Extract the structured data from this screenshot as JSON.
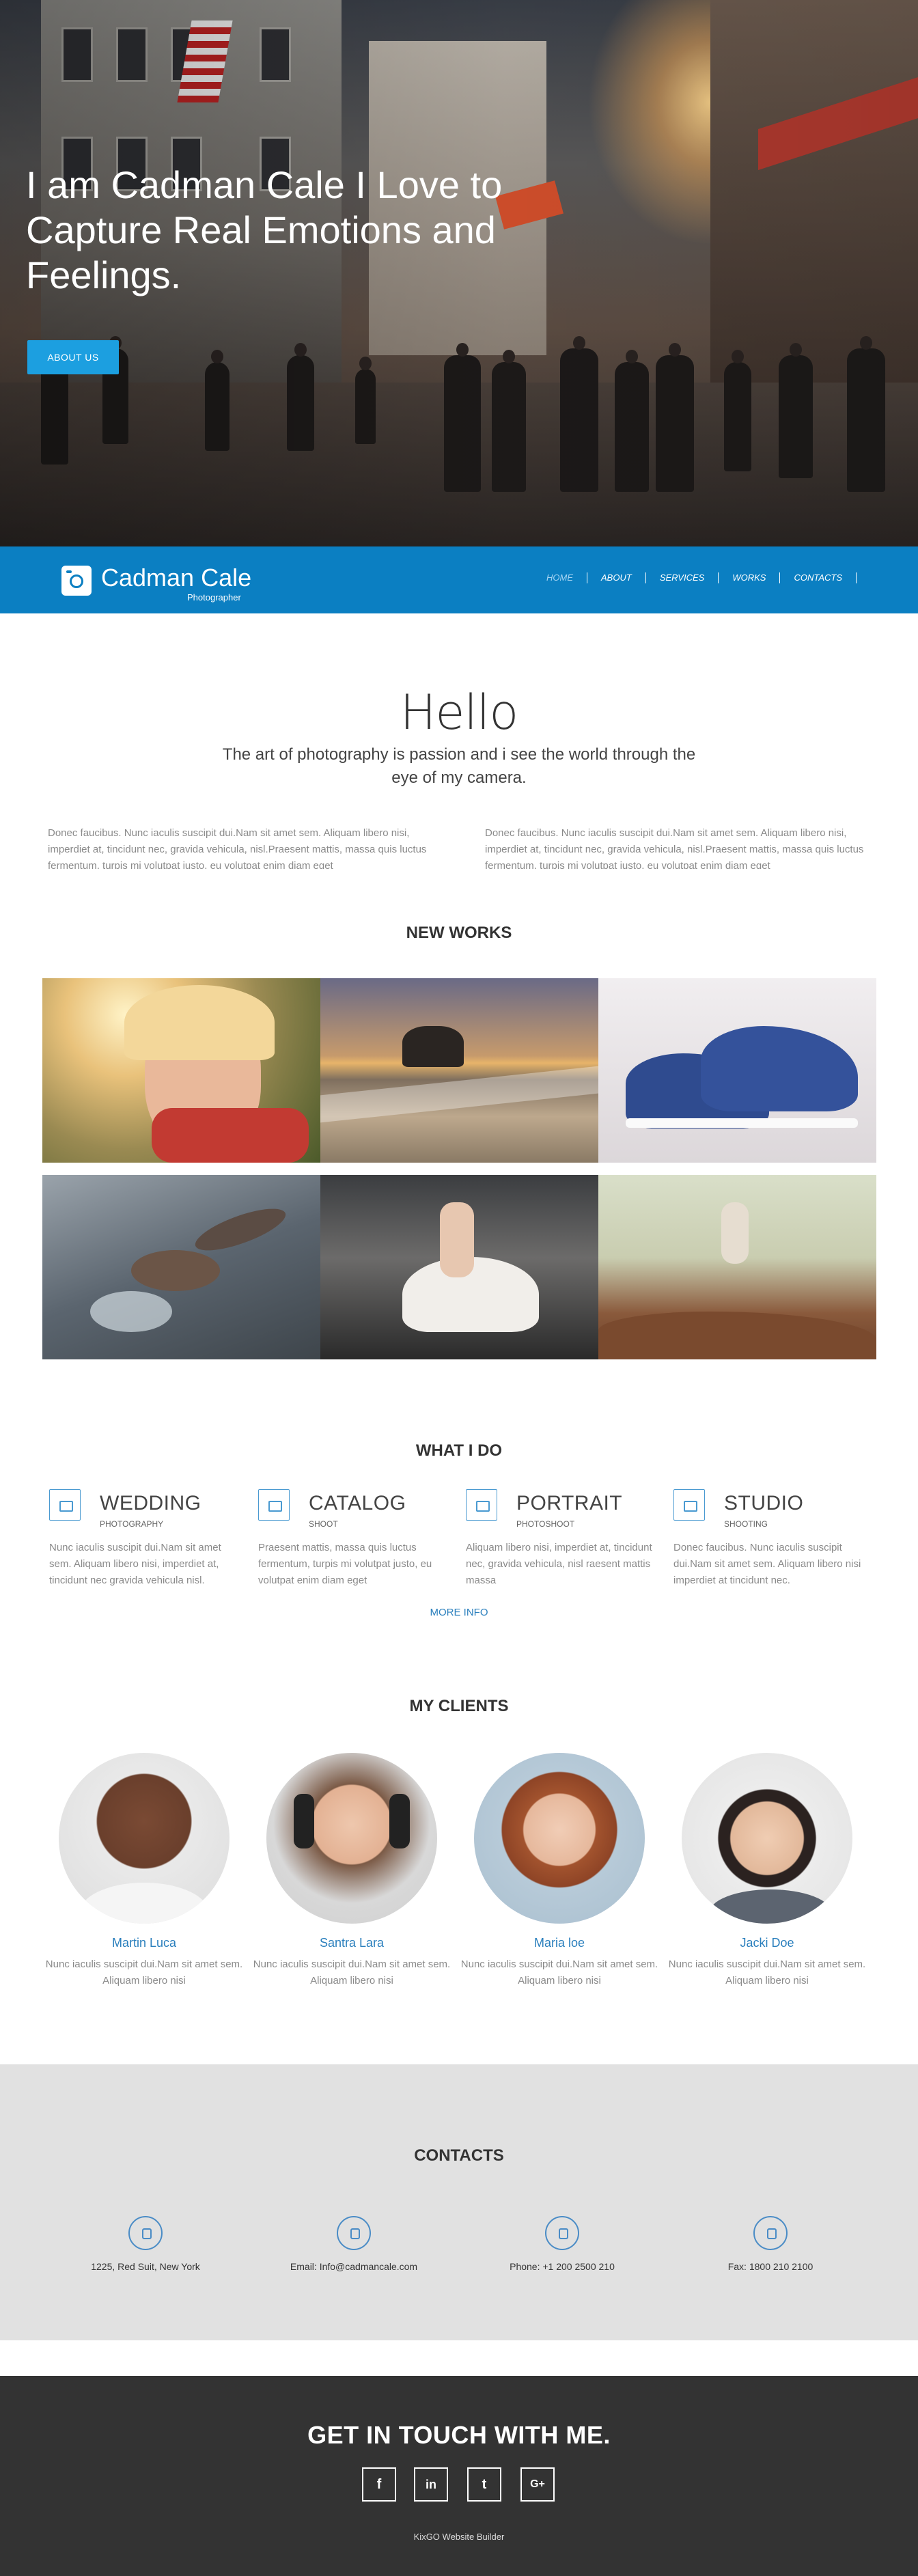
{
  "hero": {
    "title": "I am Cadman Cale I Love to Capture Real Emotions and Feelings.",
    "button_label": "ABOUT US"
  },
  "navbar": {
    "brand": "Cadman Cale",
    "tagline": "Photographer",
    "items": [
      {
        "label": "HOME",
        "active": true
      },
      {
        "label": "ABOUT",
        "active": false
      },
      {
        "label": "SERVICES",
        "active": false
      },
      {
        "label": "WORKS",
        "active": false
      },
      {
        "label": "CONTACTS",
        "active": false
      }
    ]
  },
  "hello": {
    "title": "Hello",
    "subtitle": "The art of photography is passion and i see the world through the eye of my camera.",
    "col_left": "Donec faucibus. Nunc iaculis suscipit dui.Nam sit amet sem. Aliquam libero nisi, imperdiet at, tincidunt nec, gravida vehicula, nisl.Praesent mattis, massa quis luctus fermentum, turpis mi volutpat justo, eu volutpat enim diam eget",
    "col_right": "Donec faucibus. Nunc iaculis suscipit dui.Nam sit amet sem. Aliquam libero nisi, imperdiet at, tincidunt nec, gravida vehicula, nisl.Praesent mattis, massa quis luctus fermentum, turpis mi volutpat justo, eu volutpat enim diam eget"
  },
  "works": {
    "title": "NEW WORKS"
  },
  "services": {
    "title": "WHAT I DO",
    "items": [
      {
        "title": "WEDDING",
        "subtitle": "PHOTOGRAPHY",
        "text": "Nunc iaculis suscipit dui.Nam sit amet sem. Aliquam libero nisi, imperdiet at, tincidunt nec gravida vehicula nisl."
      },
      {
        "title": "CATALOG",
        "subtitle": "SHOOT",
        "text": "Praesent mattis, massa quis luctus fermentum, turpis mi volutpat justo, eu volutpat enim diam eget"
      },
      {
        "title": "PORTRAIT",
        "subtitle": "PHOTOSHOOT",
        "text": "Aliquam libero nisi, imperdiet at, tincidunt nec, gravida vehicula, nisl raesent mattis massa"
      },
      {
        "title": "STUDIO",
        "subtitle": "SHOOTING",
        "text": "Donec faucibus. Nunc iaculis suscipit dui.Nam sit amet sem. Aliquam libero nisi imperdiet at tincidunt nec."
      }
    ],
    "more_label": "MORE INFO"
  },
  "clients": {
    "title": "MY CLIENTS",
    "items": [
      {
        "name": "Martin Luca",
        "text": "Nunc iaculis suscipit dui.Nam sit amet sem. Aliquam libero nisi"
      },
      {
        "name": "Santra Lara",
        "text": "Nunc iaculis suscipit dui.Nam sit amet sem. Aliquam libero nisi"
      },
      {
        "name": "Maria loe",
        "text": "Nunc iaculis suscipit dui.Nam sit amet sem. Aliquam libero nisi"
      },
      {
        "name": "Jacki Doe",
        "text": "Nunc iaculis suscipit dui.Nam sit amet sem. Aliquam libero nisi"
      }
    ]
  },
  "contacts": {
    "title": "CONTACTS",
    "items": [
      {
        "icon": "map-pin-icon",
        "text": "1225, Red Suit, New York"
      },
      {
        "icon": "mail-icon",
        "text": "Email: Info@cadmancale.com"
      },
      {
        "icon": "phone-icon",
        "text": "Phone: +1 200 2500 210"
      },
      {
        "icon": "fax-icon",
        "text": "Fax: 1800 210 2100"
      }
    ]
  },
  "footer": {
    "title": "GET IN TOUCH WITH ME.",
    "social": [
      {
        "icon": "facebook-icon",
        "glyph": "f"
      },
      {
        "icon": "linkedin-icon",
        "glyph": "in"
      },
      {
        "icon": "twitter-icon",
        "glyph": "t"
      },
      {
        "icon": "google-plus-icon",
        "glyph": "G+"
      }
    ],
    "note": "KixGO Website Builder"
  },
  "colors": {
    "accent": "#0b7fc2",
    "button": "#1c9fe0",
    "link": "#2a7fbd",
    "footer_bg": "#333333",
    "contacts_bg": "#e1e1e1"
  }
}
